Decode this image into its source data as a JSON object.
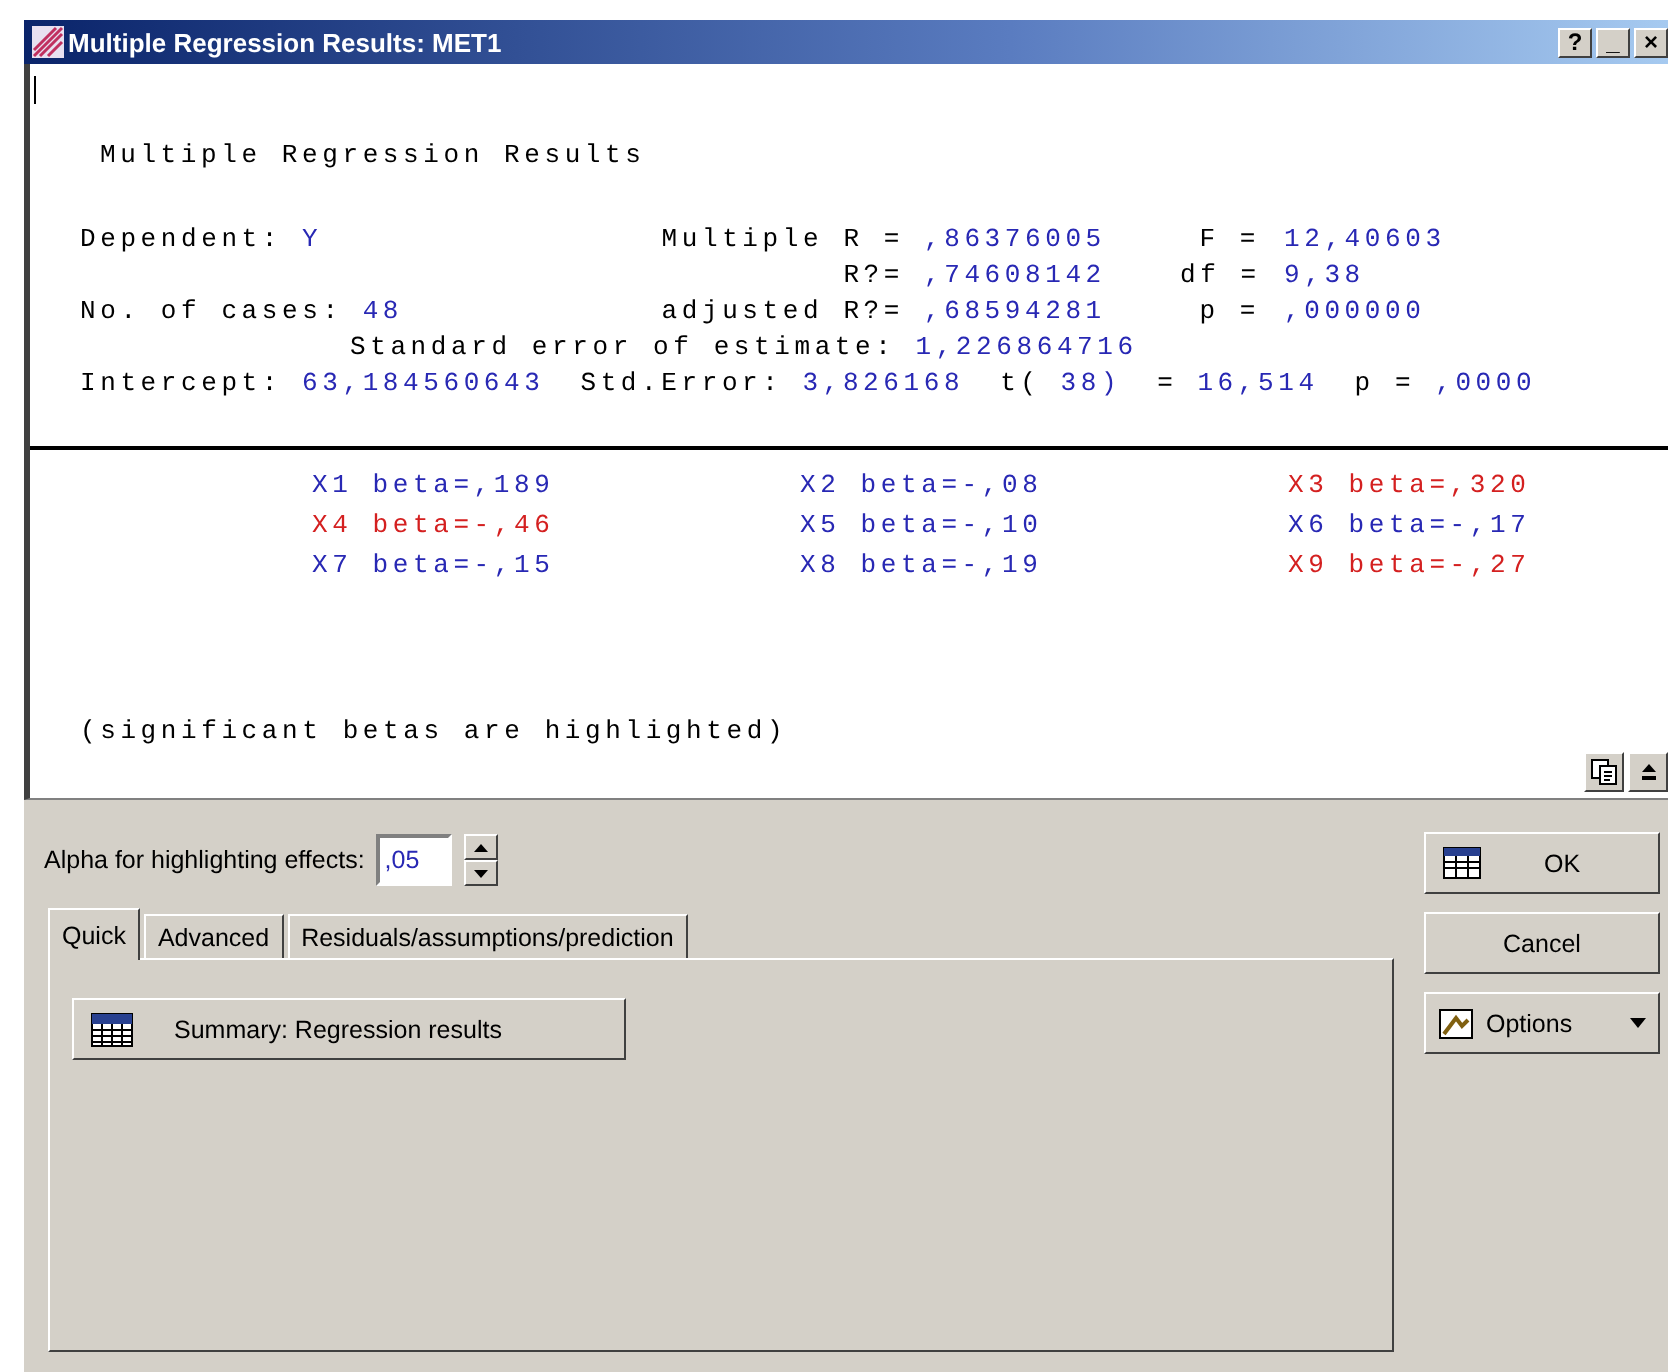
{
  "window": {
    "title": "Multiple Regression Results: MET1",
    "controls": [
      "?",
      "_",
      "×"
    ]
  },
  "output": {
    "heading": "Multiple Regression Results",
    "rows": [
      {
        "kind": "grid3",
        "cells": [
          {
            "label": "Dependent:",
            "value": "Y"
          },
          {
            "label": "Multiple R =",
            "value": ",86376005"
          },
          {
            "label": "F =",
            "value": "12,40603"
          }
        ]
      },
      {
        "kind": "grid3",
        "cells": [
          null,
          {
            "label": "R?=",
            "value": ",74608142"
          },
          {
            "label": "df =",
            "value": "9,38"
          }
        ]
      },
      {
        "kind": "grid3",
        "cells": [
          {
            "label": "No. of cases:",
            "value": "48"
          },
          {
            "label": "adjusted R?=",
            "value": ",68594281"
          },
          {
            "label": "p =",
            "value": ",000000"
          }
        ]
      },
      {
        "kind": "indent",
        "segments": [
          {
            "kind": "label",
            "text": "Standard error of estimate:"
          },
          {
            "kind": "value",
            "text": "1,226864716"
          }
        ]
      },
      {
        "kind": "flow",
        "segments": [
          {
            "kind": "label",
            "text": "Intercept:"
          },
          {
            "kind": "value",
            "text": "63,184560643"
          },
          {
            "kind": "label",
            "text": "Std.Error:"
          },
          {
            "kind": "value",
            "text": "3,826168"
          },
          {
            "kind": "label",
            "text": "t("
          },
          {
            "kind": "value",
            "text": "38)"
          },
          {
            "kind": "label",
            "text": "="
          },
          {
            "kind": "value",
            "text": "16,514"
          },
          {
            "kind": "label",
            "text": "p ="
          },
          {
            "kind": "value",
            "text": ",0000"
          }
        ]
      }
    ],
    "betas": [
      {
        "text": "X1 beta=,189",
        "significant": false
      },
      {
        "text": "X2 beta=-,08",
        "significant": false
      },
      {
        "text": "X3 beta=,320",
        "significant": true
      },
      {
        "text": "X4 beta=-,46",
        "significant": true
      },
      {
        "text": "X5 beta=-,10",
        "significant": false
      },
      {
        "text": "X6 beta=-,17",
        "significant": false
      },
      {
        "text": "X7 beta=-,15",
        "significant": false
      },
      {
        "text": "X8 beta=-,19",
        "significant": false
      },
      {
        "text": "X9 beta=-,27",
        "significant": true
      }
    ],
    "note": "(significant betas are highlighted)"
  },
  "alpha": {
    "label": "Alpha for highlighting effects:",
    "value": ",05"
  },
  "tabs": [
    {
      "label": "Quick",
      "selected": true
    },
    {
      "label": "Advanced",
      "selected": false
    },
    {
      "label": "Residuals/assumptions/prediction",
      "selected": false
    }
  ],
  "quick_buttons": [
    "Summary:  Regression results"
  ],
  "buttons": [
    {
      "kind": "ok",
      "label": "OK"
    },
    {
      "kind": "cancel",
      "label": "Cancel"
    },
    {
      "kind": "options",
      "label": "Options"
    }
  ]
}
